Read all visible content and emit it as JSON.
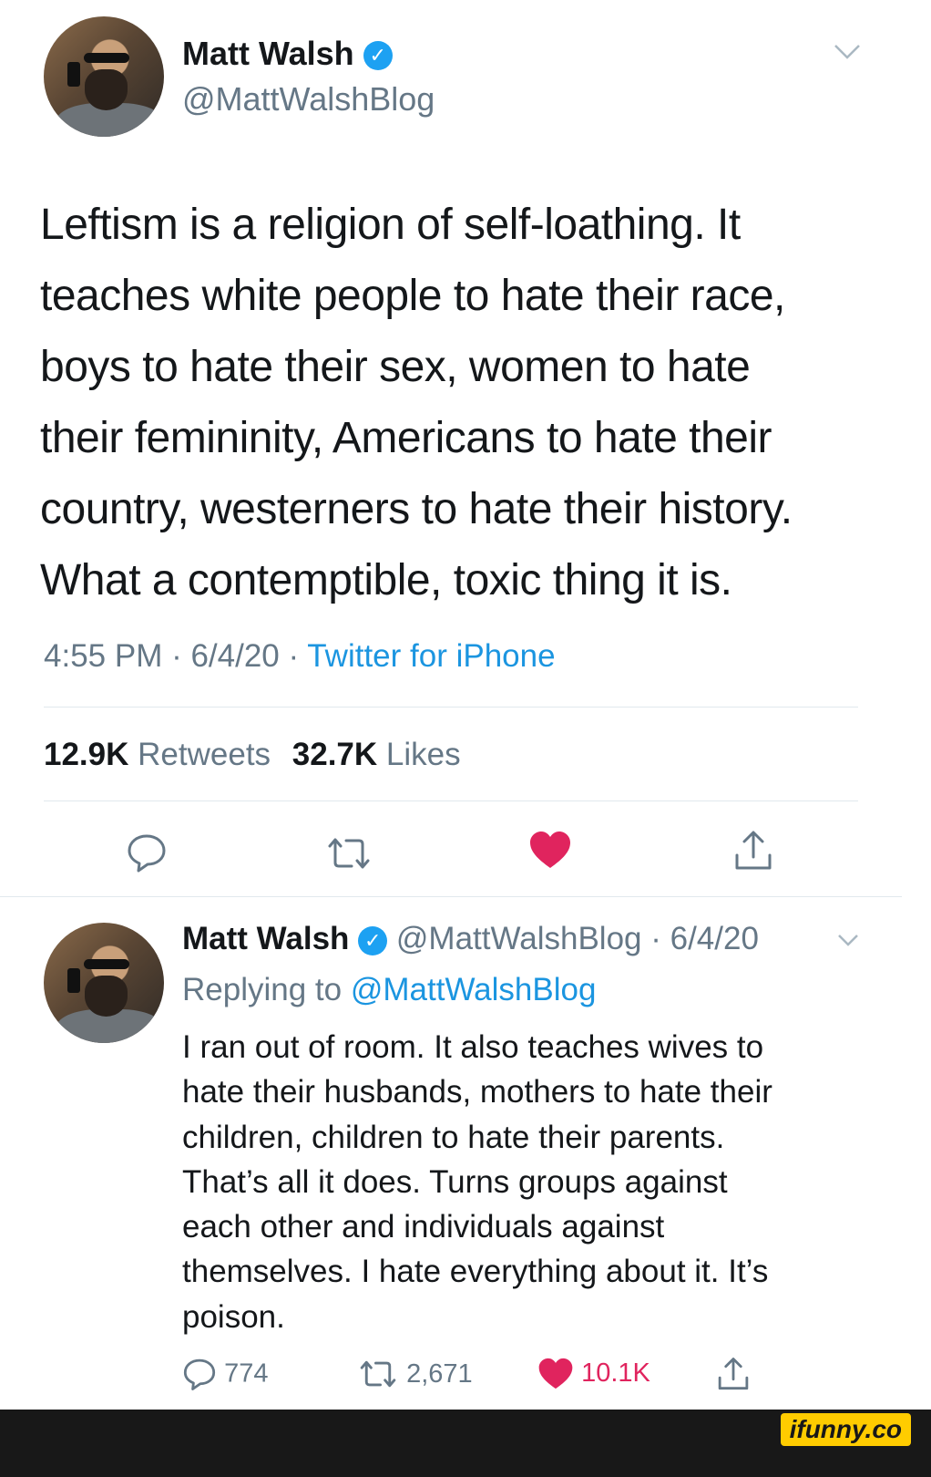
{
  "tweet": {
    "author_name": "Matt Walsh",
    "author_handle": "@MattWalshBlog",
    "text_lines": [
      "Leftism is a religion of self-loathing. It",
      "teaches white people to hate their race,",
      "boys to hate their sex, women to hate",
      "their femininity, Americans to hate their",
      "country, westerners to hate their history.",
      "What a contemptible, toxic thing it is."
    ],
    "time": "4:55 PM · 6/4/20 ·",
    "source": "Twitter for iPhone",
    "retweets_count": "12.9K",
    "retweets_label": "Retweets",
    "likes_count": "32.7K",
    "likes_label": "Likes"
  },
  "reply": {
    "author_name": "Matt Walsh",
    "author_handle_date": "@MattWalshBlog · 6/4/20",
    "replying_prefix": "Replying to",
    "replying_handle": "@MattWalshBlog",
    "text_lines": [
      "I ran out of room. It also teaches wives to",
      "hate their husbands, mothers to hate their",
      "children, children to hate their parents.",
      "That’s all it does. Turns groups against",
      "each other and individuals against",
      "themselves. I hate everything about it. It’s",
      "poison."
    ],
    "reply_count": "774",
    "retweet_count": "2,671",
    "like_count": "10.1K"
  },
  "watermark": "ifunny.co",
  "colors": {
    "accent": "#1da1f2",
    "like": "#e0245e",
    "muted": "#657786"
  },
  "icons": [
    "verified-badge-icon",
    "chevron-down-icon",
    "reply-icon",
    "retweet-icon",
    "heart-icon",
    "share-icon"
  ]
}
